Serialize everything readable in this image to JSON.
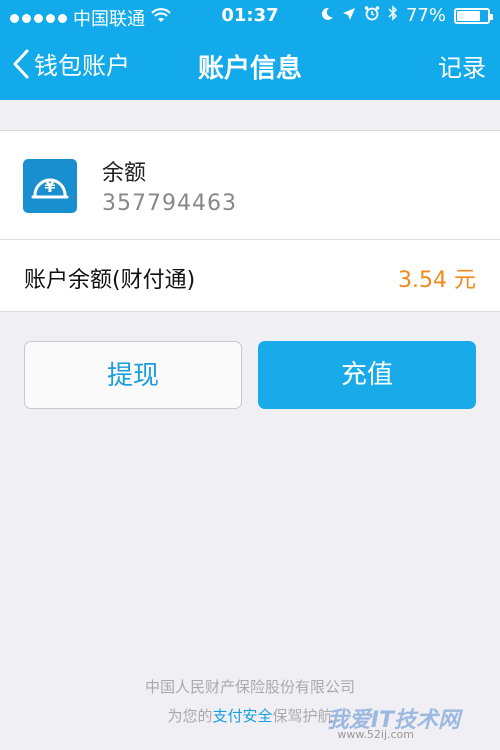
{
  "status_bar": {
    "carrier": "中国联通",
    "time": "01:37",
    "battery": "77%",
    "battery_level": 0.77
  },
  "nav": {
    "back_label": "钱包账户",
    "title": "账户信息",
    "right_label": "记录"
  },
  "balance": {
    "label": "余额",
    "number": "357794463",
    "icon_color": "#1a8fcf"
  },
  "account": {
    "label": "账户余额(财付通)",
    "value": "3.54 元"
  },
  "buttons": {
    "withdraw": "提现",
    "recharge": "充值"
  },
  "footer": {
    "line1": "中国人民财产保险股份有限公司",
    "line2_prefix": "为您的",
    "line2_link": "支付安全",
    "line2_suffix": "保驾护航"
  },
  "watermark": {
    "text": "我爱IT技术网",
    "url": "www.52ij.com"
  },
  "colors": {
    "accent": "#12aaeb",
    "amount": "#f08a1c",
    "background": "#efeff4"
  }
}
